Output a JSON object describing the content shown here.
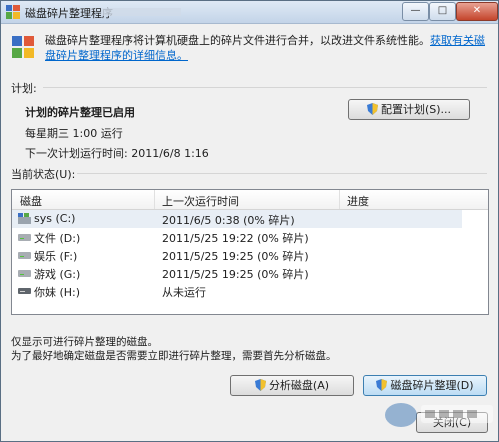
{
  "window": {
    "title": "磁盘碎片整理程序",
    "minimize": "—",
    "maximize": "□",
    "close": "✕"
  },
  "header": {
    "description": "磁盘碎片整理程序将计算机硬盘上的碎片文件进行合并，以改进文件系统性能。",
    "link": "获取有关磁盘碎片整理程序的详细信息。"
  },
  "schedule": {
    "section_label": "计划:",
    "status": "计划的碎片整理已启用",
    "frequency": "每星期三  1:00 运行",
    "next_run": "下一次计划运行时间: 2011/6/8 1:16",
    "configure_button": "配置计划(S)..."
  },
  "current_status": {
    "section_label": "当前状态(U):",
    "columns": [
      "磁盘",
      "上一次运行时间",
      "进度"
    ],
    "disks": [
      {
        "name": "sys (C:)",
        "last_run": "2011/6/5 0:38 (0% 碎片)",
        "progress": "",
        "icon": "system-drive-icon"
      },
      {
        "name": "文件 (D:)",
        "last_run": "2011/5/25 19:22 (0% 碎片)",
        "progress": "",
        "icon": "drive-icon"
      },
      {
        "name": "娱乐 (F:)",
        "last_run": "2011/5/25 19:25 (0% 碎片)",
        "progress": "",
        "icon": "drive-icon"
      },
      {
        "name": "游戏 (G:)",
        "last_run": "2011/5/25 19:25 (0% 碎片)",
        "progress": "",
        "icon": "drive-icon"
      },
      {
        "name": "你妹 (H:)",
        "last_run": "从未运行",
        "progress": "",
        "icon": "removable-drive-icon"
      }
    ]
  },
  "footer": {
    "note1": "仅显示可进行碎片整理的磁盘。",
    "note2": "为了最好地确定磁盘是否需要立即进行碎片整理，需要首先分析磁盘。",
    "analyze_button": "分析磁盘(A)",
    "defrag_button": "磁盘碎片整理(D)",
    "close_button": "关闭(C)"
  },
  "colors": {
    "link": "#0066cc",
    "selected_row": "#e8eef5",
    "window_bg": "#f0f0f0"
  }
}
